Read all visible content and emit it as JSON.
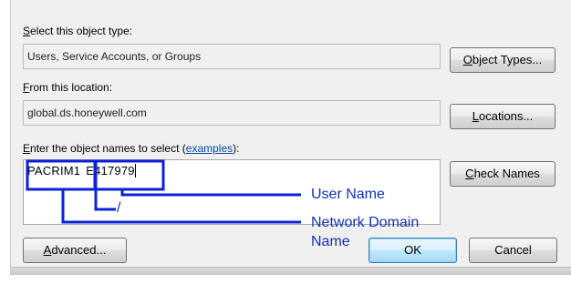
{
  "object_type": {
    "label": "Select this object type:",
    "value": "Users, Service Accounts, or Groups",
    "button": "Object Types..."
  },
  "location": {
    "label": "From this location:",
    "value": "global.ds.honeywell.com",
    "button": "Locations..."
  },
  "names": {
    "label_prefix": "Enter the object names to select (",
    "label_link": "examples",
    "label_suffix": "):",
    "domain_part": "PACRIM1",
    "user_part": "E417979",
    "check_button": "Check Names"
  },
  "annotations": {
    "user_name": "User Name",
    "slash_mark": "/",
    "network_domain": "Network Domain",
    "name_word": "Name",
    "line_color": "#0a22d8"
  },
  "footer": {
    "advanced": "Advanced...",
    "ok": "OK",
    "cancel": "Cancel"
  }
}
